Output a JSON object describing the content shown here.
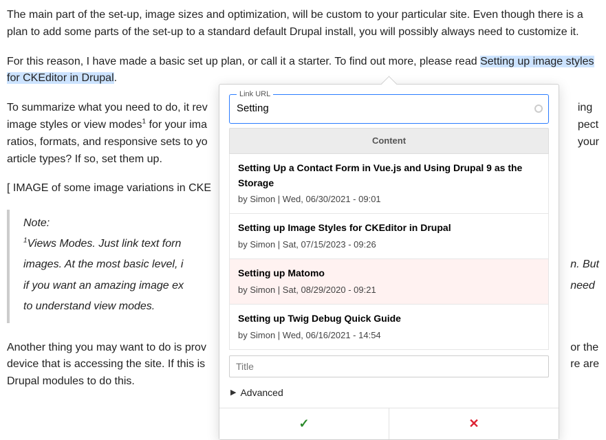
{
  "article": {
    "para1": "The main part of the set-up, image sizes and optimization, will be custom to your particular site. Even though there is a plan to add some parts of the set-up to a standard default Drupal install, you will possibly always need to customize it.",
    "para2_before": "For this reason, I have made a basic set up plan, or call it a starter. To find out more, please read ",
    "para2_link": "Setting up image styles for CKEditor in Drupal",
    "para2_after": ".",
    "para3_a": "To summarize what you need to do, it rev",
    "para3_b": "image styles or view modes",
    "fn1": "1",
    "para3_c": " for your ima",
    "para3_d": "ratios, formats, and responsive sets to yo",
    "para3_e": "article types? If so, set them up.",
    "para3_right1": "ing",
    "para3_right2": "pect",
    "para3_right3": "your",
    "placeholder": "[ IMAGE of some image variations in CKE",
    "note_label": "Note:",
    "note_fn": "1",
    "note_line1": "Views Modes. Just link text forn",
    "note_line2": "images. At the most basic level, i",
    "note_line3": "if you want an amazing image ex",
    "note_line4": "to understand view modes.",
    "note_right1": "n. But",
    "note_right2": "need",
    "para4_a": "Another thing you may want to do is prov",
    "para4_b": "device that is accessing the site. If this is",
    "para4_c": "Drupal modules to do this.",
    "para4_right1": "or the",
    "para4_right2": "re are"
  },
  "dialog": {
    "link_url_label": "Link URL",
    "link_url_value": "Setting",
    "section_header": "Content",
    "results": [
      {
        "title": "Setting Up a Contact Form in Vue.js and Using Drupal 9 as the Storage",
        "meta": "by Simon | Wed, 06/30/2021 - 09:01"
      },
      {
        "title": "Setting up Image Styles for CKEditor in Drupal",
        "meta": "by Simon | Sat, 07/15/2023 - 09:26"
      },
      {
        "title": "Setting up Matomo",
        "meta": "by Simon | Sat, 08/29/2020 - 09:21"
      },
      {
        "title": "Setting up Twig Debug Quick Guide",
        "meta": "by Simon | Wed, 06/16/2021 - 14:54"
      }
    ],
    "title_placeholder": "Title",
    "advanced_label": "Advanced"
  }
}
